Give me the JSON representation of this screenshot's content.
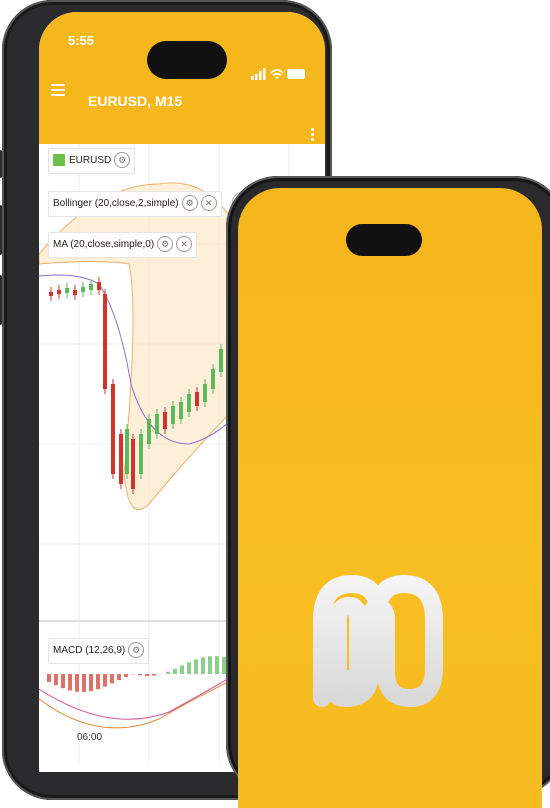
{
  "back_phone": {
    "status_time": "5:55",
    "title": "EURUSD, M15",
    "symbol_label": "EURUSD",
    "indicators": [
      {
        "label": "Bollinger (20,close,2,simple)"
      },
      {
        "label": "MA (20,close,simple,0)"
      }
    ],
    "time_axis_label": "06:00",
    "macd_label": "MACD (12,26,9)",
    "colors": {
      "header": "#f5b81c",
      "bull": "#5cb85c",
      "bear": "#d0352b",
      "band_fill": "#fde8c8",
      "band_line": "#f0b070",
      "ma_line": "#8a6fd1"
    }
  },
  "front_phone": {
    "background_color": "#f6b81e",
    "logo_icon": "m-logo-icon"
  }
}
